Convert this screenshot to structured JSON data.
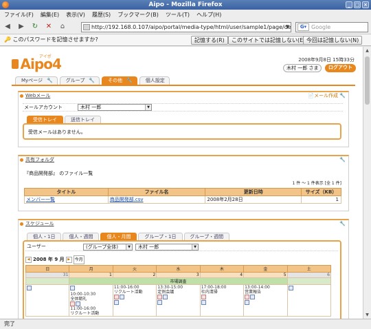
{
  "browser": {
    "window_title": "Aipo - Mozilla Firefox",
    "menu": [
      "ファイル(F)",
      "編集(E)",
      "表示(V)",
      "履歴(S)",
      "ブックマーク(B)",
      "ツール(T)",
      "ヘルプ(H)"
    ],
    "url": "http://192.168.0.107/aipo/portal/media-type/html/user/sample1/page/de",
    "search_placeholder": "Google",
    "password_bar": {
      "message": "このパスワードを記憶させますか?",
      "remember": "記憶する(R)",
      "never": "このサイトでは記憶しない(E)",
      "not_now": "今回は記憶しない(N)"
    },
    "status": "完了"
  },
  "header": {
    "logo_text": "Aipo",
    "logo_version": "4",
    "logo_ruby": "アイポ",
    "date": "2008年9月8日 15時33分",
    "user_button": "木村 一郎 さま",
    "logout_button": "ログアウト"
  },
  "tabs": [
    {
      "label": "Myページ"
    },
    {
      "label": "グループ"
    },
    {
      "label": "その他"
    },
    {
      "label": "個人設定"
    }
  ],
  "webmail": {
    "title": "Webメール",
    "compose": "メール作成",
    "account_label": "メールアカウント",
    "account_value": "木村 一郎",
    "tab_inbox": "受信トレイ",
    "tab_sent": "送信トレイ",
    "empty_message": "受信メールはありません。"
  },
  "folder": {
    "title": "共有フォルダ",
    "heading": "『商品開発部』 のファイル一覧",
    "pager": "1 件 ～ 1 件表示 [全 1 件]",
    "columns": [
      "タイトル",
      "ファイル名",
      "更新日時",
      "サイズ（KB）"
    ],
    "rows": [
      {
        "title": "メンバー一覧",
        "file": "商品開発部.csv",
        "updated": "2008年2月28日",
        "size": "1"
      }
    ]
  },
  "schedule": {
    "title": "スケジュール",
    "view_tabs": [
      "個人・1日",
      "個人・週間",
      "個人・月間",
      "グループ・1日",
      "グループ・週間"
    ],
    "user_label": "ユーザー",
    "group_select": "(グループ全体)",
    "user_select": "木村 一郎",
    "month_nav": "2008 年 9 月",
    "today_button": "今月",
    "weekdays": [
      "日",
      "月",
      "火",
      "水",
      "木",
      "金",
      "土"
    ],
    "day_numbers": [
      "31",
      "1",
      "2",
      "3",
      "4",
      "5",
      "6"
    ],
    "holiday_event": "市場調査",
    "events": [
      [],
      [
        {
          "time": "10:00-10:30",
          "title": "全体朝礼"
        },
        {
          "time": "11:00-16:00",
          "title": "リクルート活動"
        }
      ],
      [
        {
          "time": "11:00-16:00",
          "title": "リクルート活動"
        }
      ],
      [
        {
          "time": "13:30-15:00",
          "title": "定例会議"
        }
      ],
      [
        {
          "time": "17:00-18:00",
          "title": "社内清掃"
        }
      ],
      [
        {
          "time": "13:00-14:00",
          "title": "営業報告"
        }
      ],
      []
    ]
  }
}
